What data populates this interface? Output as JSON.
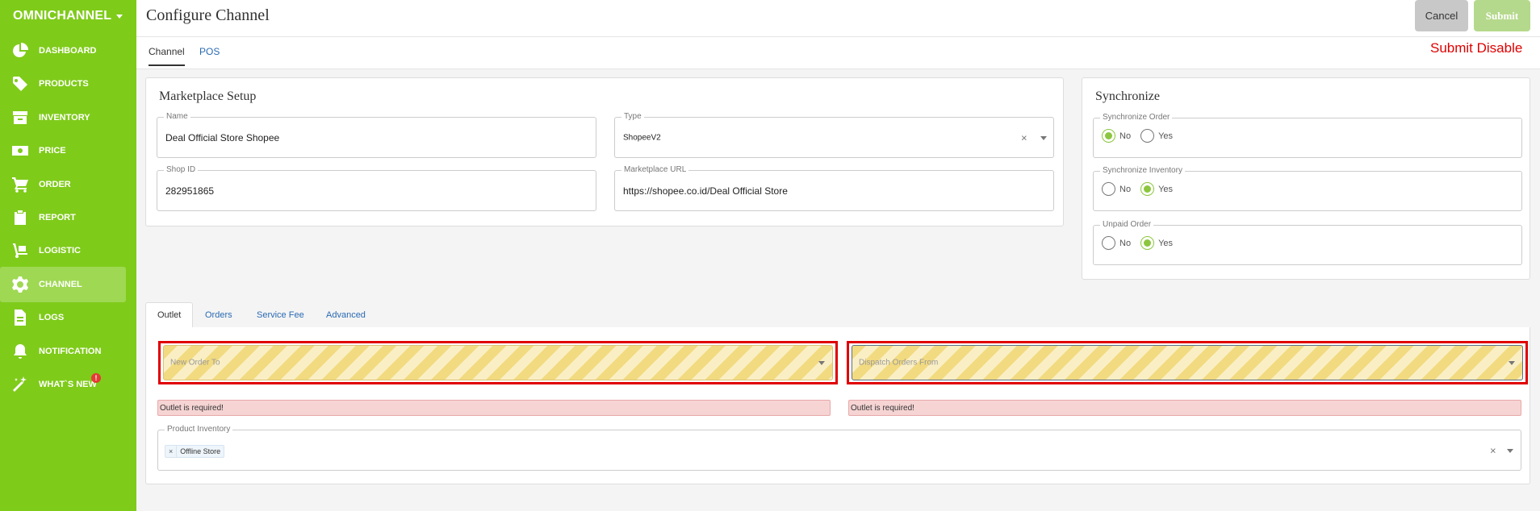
{
  "sidebar": {
    "brand": "OMNICHANNEL",
    "items": [
      {
        "label": "DASHBOARD",
        "icon": "pie-chart-icon"
      },
      {
        "label": "PRODUCTS",
        "icon": "tag-icon"
      },
      {
        "label": "INVENTORY",
        "icon": "archive-icon"
      },
      {
        "label": "PRICE",
        "icon": "money-icon"
      },
      {
        "label": "ORDER",
        "icon": "cart-icon"
      },
      {
        "label": "REPORT",
        "icon": "clipboard-icon"
      },
      {
        "label": "LOGISTIC",
        "icon": "dolly-icon"
      },
      {
        "label": "CHANNEL",
        "icon": "gear-icon"
      },
      {
        "label": "LOGS",
        "icon": "file-icon"
      },
      {
        "label": "NOTIFICATION",
        "icon": "bell-icon"
      },
      {
        "label": "WHAT`S NEW",
        "icon": "magic-wand-icon",
        "badge": "!"
      }
    ],
    "active": "CHANNEL"
  },
  "header": {
    "title": "Configure Channel",
    "cancel_label": "Cancel",
    "submit_label": "Submit"
  },
  "tabs": [
    {
      "label": "Channel",
      "active": true
    },
    {
      "label": "POS",
      "active": false
    }
  ],
  "annotation": "Submit Disable",
  "marketplace": {
    "title": "Marketplace Setup",
    "name_label": "Name",
    "name_value": "Deal Official Store Shopee",
    "type_label": "Type",
    "type_value": "ShopeeV2",
    "shopid_label": "Shop ID",
    "shopid_value": "282951865",
    "url_label": "Marketplace URL",
    "url_value": "https://shopee.co.id/Deal Official Store"
  },
  "synchronize": {
    "title": "Synchronize",
    "groups": [
      {
        "label": "Synchronize Order",
        "no": "No",
        "yes": "Yes",
        "selected": "No"
      },
      {
        "label": "Synchronize Inventory",
        "no": "No",
        "yes": "Yes",
        "selected": "Yes"
      },
      {
        "label": "Unpaid Order",
        "no": "No",
        "yes": "Yes",
        "selected": "Yes"
      }
    ]
  },
  "sub_tabs": [
    {
      "label": "Outlet",
      "active": true
    },
    {
      "label": "Orders",
      "active": false
    },
    {
      "label": "Service Fee",
      "active": false
    },
    {
      "label": "Advanced",
      "active": false
    }
  ],
  "outlet": {
    "new_order_placeholder": "New Order To",
    "dispatch_placeholder": "Dispatch Orders From",
    "error_left": "Outlet is required!",
    "error_right": "Outlet is required!",
    "product_inventory_label": "Product Inventory",
    "chip_remove": "×",
    "chip_label": "Offline Store"
  },
  "colors": {
    "sidebar": "#7fcb1a",
    "accent_radio": "#8cc63f",
    "error_border": "#e00000",
    "link": "#2a6ab3"
  }
}
